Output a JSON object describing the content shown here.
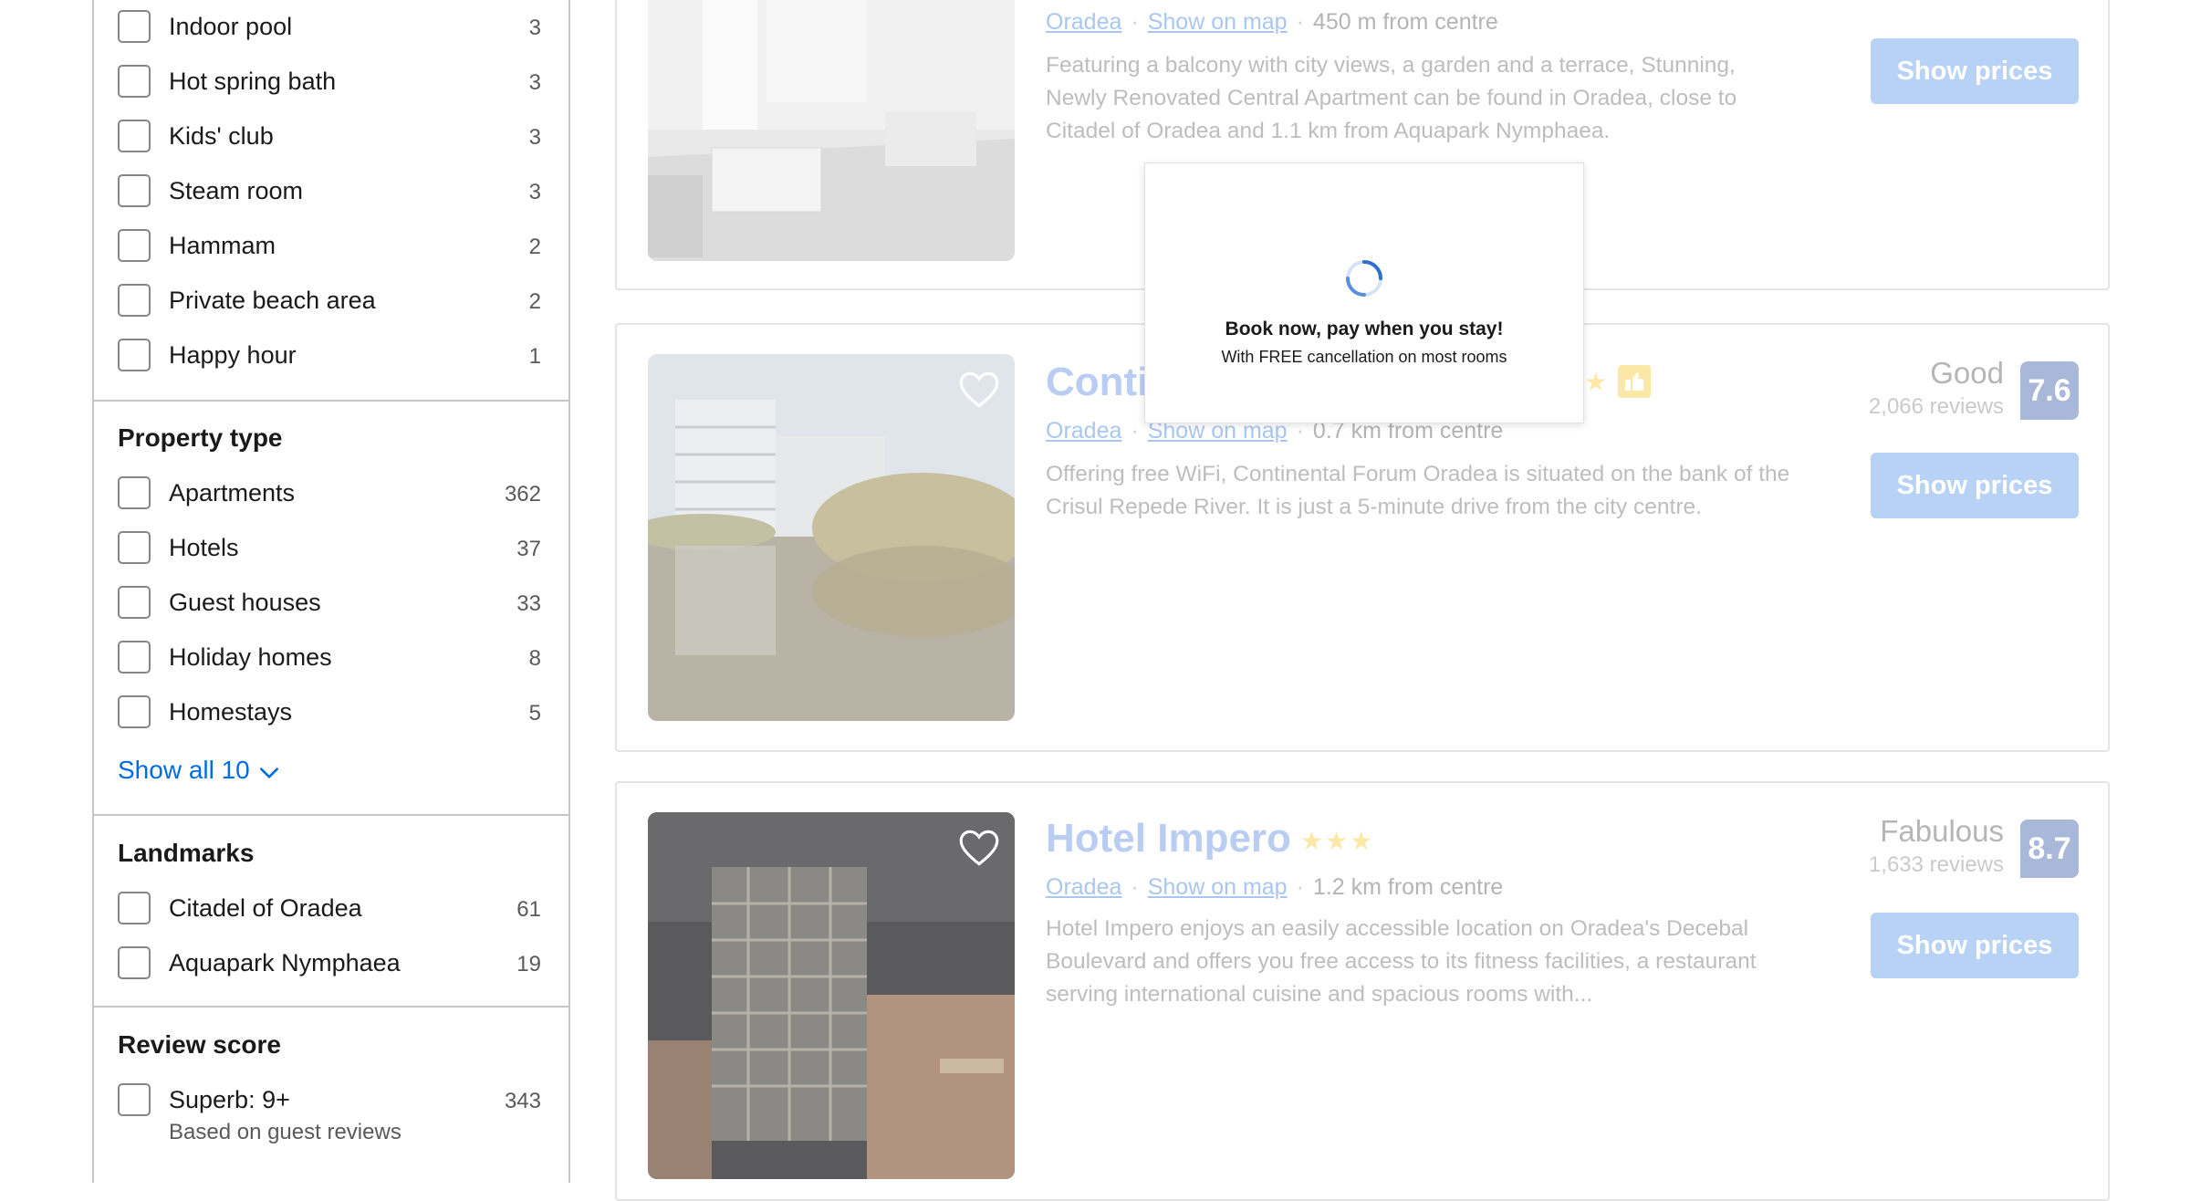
{
  "sidebar": {
    "facilities": [
      {
        "label": "Indoor pool",
        "count": "3"
      },
      {
        "label": "Hot spring bath",
        "count": "3"
      },
      {
        "label": "Kids' club",
        "count": "3"
      },
      {
        "label": "Steam room",
        "count": "3"
      },
      {
        "label": "Hammam",
        "count": "2"
      },
      {
        "label": "Private beach area",
        "count": "2"
      },
      {
        "label": "Happy hour",
        "count": "1"
      }
    ],
    "property_type": {
      "title": "Property type",
      "items": [
        {
          "label": "Apartments",
          "count": "362"
        },
        {
          "label": "Hotels",
          "count": "37"
        },
        {
          "label": "Guest houses",
          "count": "33"
        },
        {
          "label": "Holiday homes",
          "count": "8"
        },
        {
          "label": "Homestays",
          "count": "5"
        }
      ],
      "show_all": "Show all 10"
    },
    "landmarks": {
      "title": "Landmarks",
      "items": [
        {
          "label": "Citadel of Oradea",
          "count": "61"
        },
        {
          "label": "Aquapark Nymphaea",
          "count": "19"
        }
      ]
    },
    "review_score": {
      "title": "Review score",
      "items": [
        {
          "label": "Superb: 9+",
          "count": "343",
          "sub": "Based on guest reviews"
        }
      ]
    }
  },
  "results": [
    {
      "title": "",
      "city": "Oradea",
      "map_link": "Show on map",
      "distance": "450 m from centre",
      "description": "Featuring a balcony with city views, a garden and a terrace, Stunning, Newly Renovated Central Apartment can be found in Oradea, close to Citadel of Oradea and 1.1 km from Aquapark Nymphaea.",
      "button": "Show prices"
    },
    {
      "title": "Conti",
      "stars": "★",
      "city": "Oradea",
      "map_link": "Show on map",
      "distance": "0.7 km from centre",
      "description": "Offering free WiFi, Continental Forum Oradea is situated on the bank of the Crisul Repede River. It is just a 5-minute drive from the city centre.",
      "score_word": "Good",
      "reviews": "2,066 reviews",
      "score": "7.6",
      "button": "Show prices"
    },
    {
      "title": "Hotel Impero",
      "stars": "★★★",
      "city": "Oradea",
      "map_link": "Show on map",
      "distance": "1.2 km from centre",
      "description": "Hotel Impero enjoys an easily accessible location on Oradea's Decebal Boulevard and offers you free access to its fitness facilities, a restaurant serving international cuisine and spacious rooms with...",
      "score_word": "Fabulous",
      "reviews": "1,633 reviews",
      "score": "8.7",
      "button": "Show prices"
    }
  ],
  "popup": {
    "title": "Book now, pay when you stay!",
    "subtitle": "With FREE cancellation on most rooms"
  },
  "colors": {
    "link": "#006ce4",
    "badge_faded": "#a9b7d9",
    "button_faded": "#b7d2f4",
    "spinner": "#2d6fd1"
  }
}
